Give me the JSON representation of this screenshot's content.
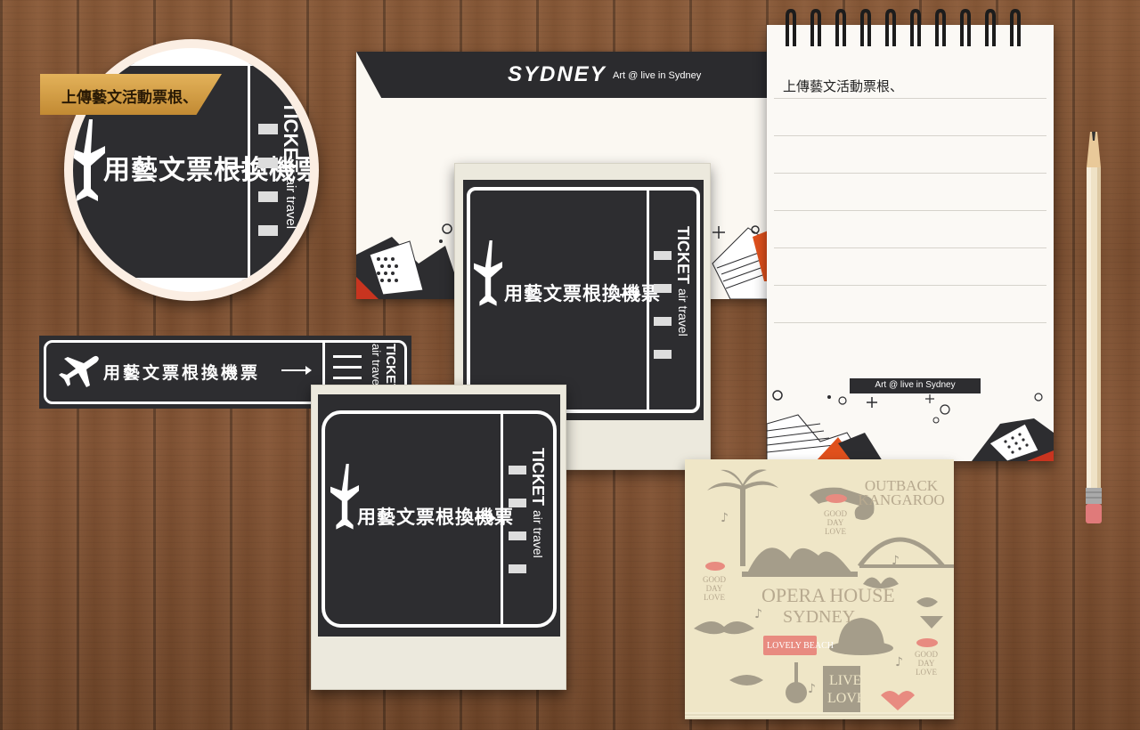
{
  "zoom": {
    "tag_label": "上傳藝文活動票根、",
    "ticket_text": "用藝文票根換機票",
    "ticket_title": "TICKET",
    "ticket_subtitle": "air travel"
  },
  "banner": {
    "text": "用藝文票根換機票",
    "title": "TICKET",
    "subtitle": "air travel"
  },
  "envelope": {
    "logo": "SYDNEY",
    "tagline": "Art @ live in Sydney"
  },
  "polaroid_top": {
    "text": "用藝文票根換機票",
    "title": "TICKET",
    "subtitle": "air travel"
  },
  "polaroid_bottom": {
    "text": "用藝文票根換機票",
    "title": "TICKET",
    "subtitle": "air travel"
  },
  "notepad": {
    "title": "上傳藝文活動票根、",
    "tagline": "Art @ live in Sydney"
  },
  "sticky": {
    "kangaroo": "OUTBACK KANGAROO",
    "opera": "OPERA HOUSE",
    "sydney": "SYDNEY",
    "good_day_love": "GOOD DAY LOVE",
    "lovely_beach": "LOVELY BEACH",
    "live": "LIVE",
    "love": "LOVE"
  },
  "colors": {
    "ticket_dark": "#2d2d30",
    "gold": "#d9a447",
    "accent_red": "#c8341f",
    "accent_orange": "#e0501c",
    "wood": "#7d4f30"
  }
}
